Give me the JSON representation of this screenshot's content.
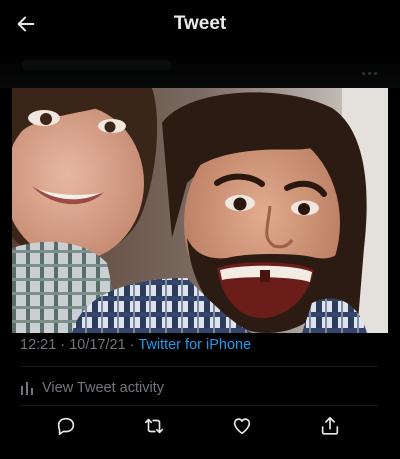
{
  "header": {
    "title": "Tweet",
    "back_icon": "arrow-left-icon"
  },
  "tweet": {
    "more_icon": "more-horizontal-icon",
    "time": "12:21",
    "date": "10/17/21",
    "separator": "·",
    "source": "Twitter for iPhone",
    "activity_label": "View Tweet activity",
    "activity_icon": "bar-chart-icon"
  },
  "actions": [
    {
      "name": "reply-icon"
    },
    {
      "name": "retweet-icon"
    },
    {
      "name": "like-icon"
    },
    {
      "name": "share-icon"
    }
  ],
  "colors": {
    "background": "#000000",
    "text": "#e7e9ea",
    "secondary": "#71767b",
    "accent": "#1d9bf0"
  }
}
